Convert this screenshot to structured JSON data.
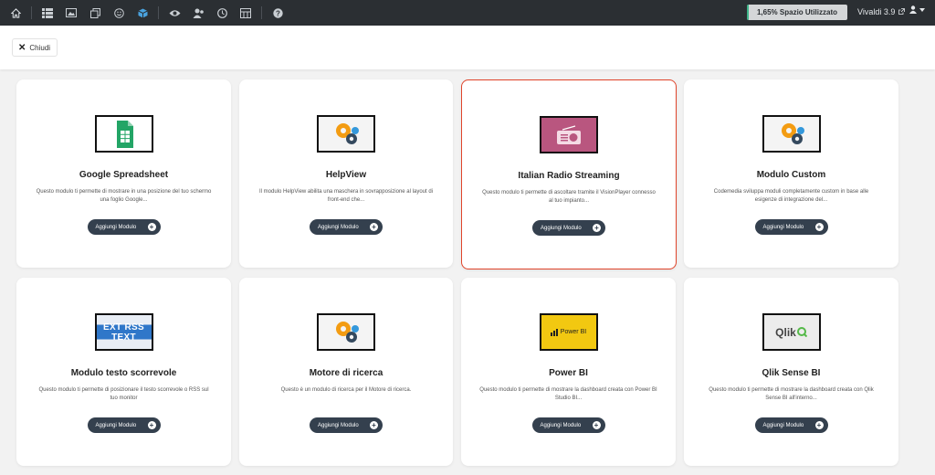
{
  "topbar": {
    "icons": [
      "home-icon",
      "list-icon",
      "image-icon",
      "copy-icon",
      "smile-icon",
      "cube-icon",
      "eye-icon",
      "users-icon",
      "clock-icon",
      "layout-icon",
      "help-icon"
    ],
    "storage_label": "1,65% Spazio Utilizzato",
    "storage_fraction": 0.0165,
    "version_label": "Vivaldi 3.9",
    "user_icon": "user-icon"
  },
  "header": {
    "close_label": "Chiudi"
  },
  "cards": [
    {
      "title": "Google Spreadsheet",
      "desc": "Questo modulo ti permette di mostrare in una posizione del tuo schermo una foglio Google...",
      "button": "Aggiungi Modulo",
      "thumb": "google-sheets-icon"
    },
    {
      "title": "HelpView",
      "desc": "Il modulo HelpView abilita una maschera in sovrapposizione al layout di front-end che...",
      "button": "Aggiungi Modulo",
      "thumb": "gears-icon"
    },
    {
      "title": "Italian Radio Streaming",
      "desc": "Questo modulo ti permette di ascoltare tramite il VisionPlayer connesso al tuo impianto...",
      "button": "Aggiungi Modulo",
      "thumb": "radio-icon"
    },
    {
      "title": "Modulo Custom",
      "desc": "Codemedia sviluppa moduli completamente custom in base alle esigenze di integrazione del...",
      "button": "Aggiungi Modulo",
      "thumb": "gears-icon"
    },
    {
      "title": "Modulo testo scorrevole",
      "desc": "Questo modulo ti permette di posizionare il testo scorrevole o RSS sul tuo monitor",
      "button": "Aggiungi Modulo",
      "thumb": "rss-text-icon",
      "thumb_text": "EXT RSS TEXT"
    },
    {
      "title": "Motore di ricerca",
      "desc": "Questo è un modulo di ricerca per il Motore di ricerca.",
      "button": "Aggiungi Modulo",
      "thumb": "gears-icon"
    },
    {
      "title": "Power BI",
      "desc": "Questo modulo ti permette di mostrare la dashboard creata con Power BI Studio BI...",
      "button": "Aggiungi Modulo",
      "thumb": "power-bi-icon",
      "thumb_text": "Power BI"
    },
    {
      "title": "Qlik Sense BI",
      "desc": "Questo modulo ti permette di mostrare la dashboard creata con Qlik Sense BI all'interno...",
      "button": "Aggiungi Modulo",
      "thumb": "qlik-icon",
      "thumb_text": "Qlik"
    }
  ]
}
